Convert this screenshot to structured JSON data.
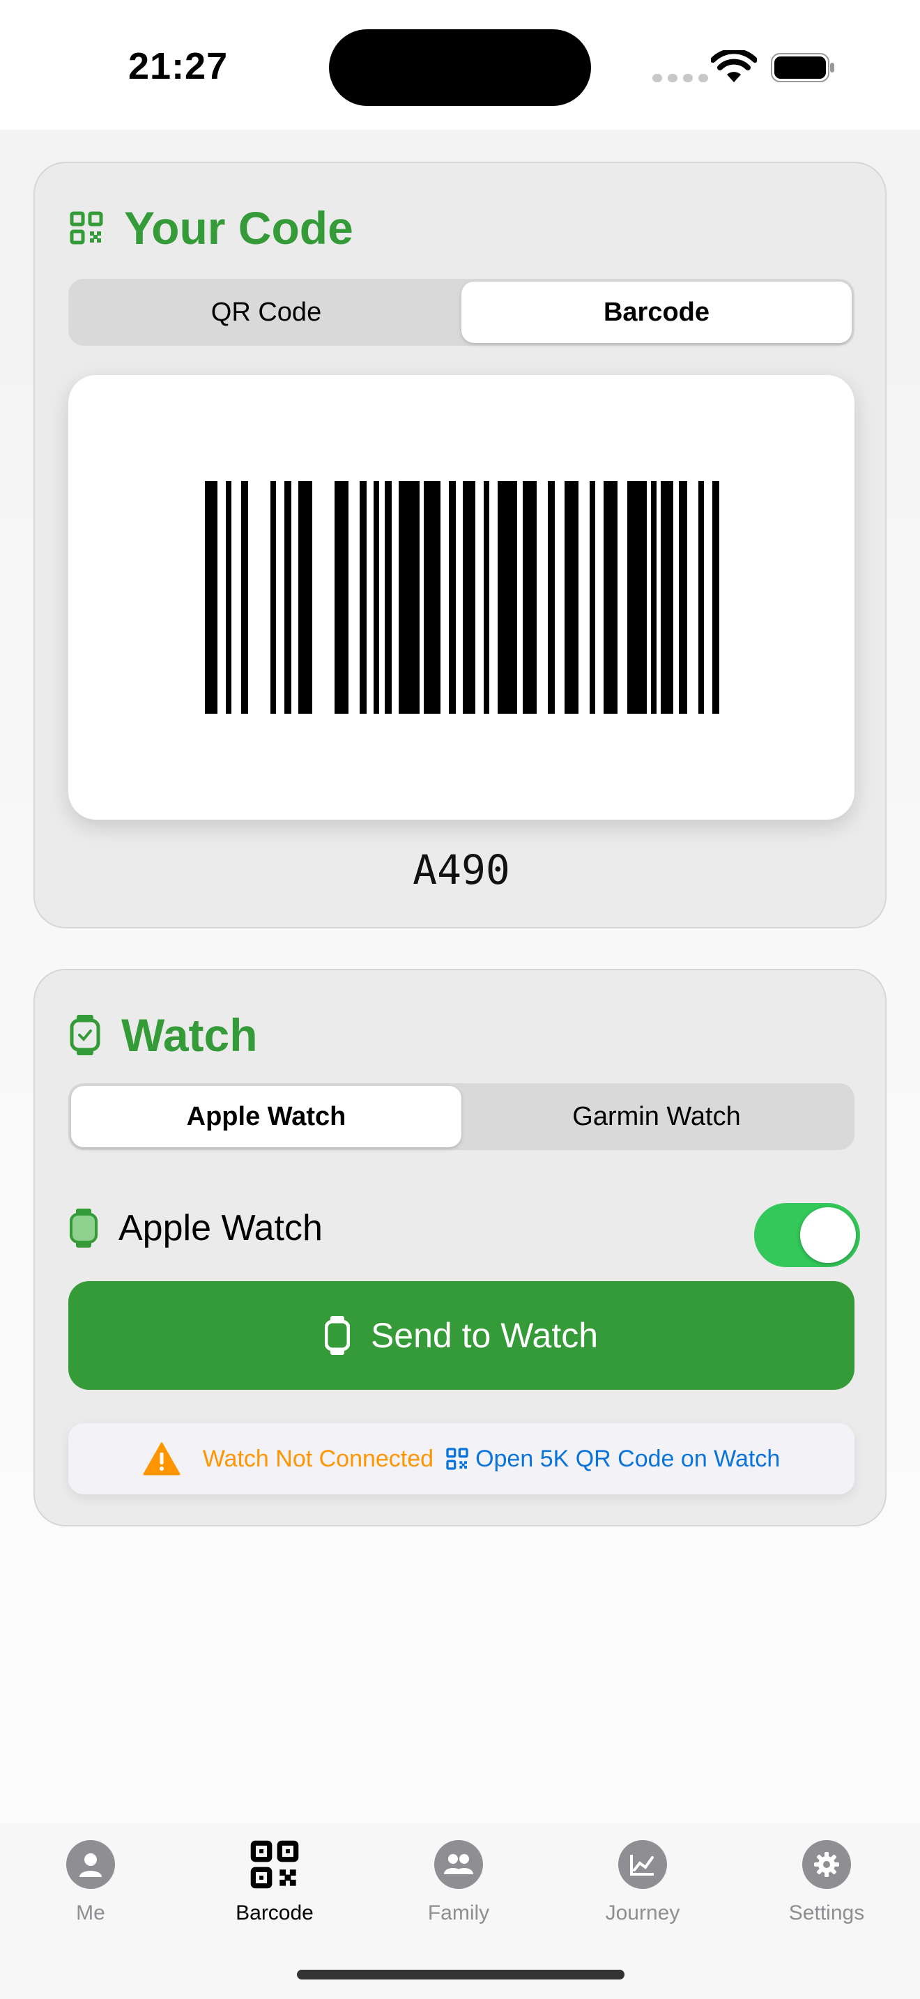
{
  "status_bar": {
    "time": "21:27"
  },
  "code_card": {
    "title": "Your Code",
    "title_icon": "qr-code-icon",
    "tabs": [
      {
        "label": "QR Code",
        "active": false
      },
      {
        "label": "Barcode",
        "active": true
      }
    ],
    "code_value": "A490"
  },
  "watch_card": {
    "title": "Watch",
    "title_icon": "watch-icon",
    "tabs": [
      {
        "label": "Apple Watch",
        "active": true
      },
      {
        "label": "Garmin Watch",
        "active": false
      }
    ],
    "toggle_label": "Apple Watch",
    "toggle_on": true,
    "send_button": "Send to Watch",
    "notice_warning": "Watch Not Connected",
    "notice_link": "Open 5K QR Code on Watch"
  },
  "tab_bar": {
    "items": [
      {
        "label": "Me",
        "icon": "person-icon",
        "active": false
      },
      {
        "label": "Barcode",
        "icon": "qr-code-icon",
        "active": true
      },
      {
        "label": "Family",
        "icon": "family-icon",
        "active": false
      },
      {
        "label": "Journey",
        "icon": "chart-icon",
        "active": false
      },
      {
        "label": "Settings",
        "icon": "gear-icon",
        "active": false
      }
    ]
  },
  "colors": {
    "brand_green": "#359b38",
    "toggle_green": "#34c759",
    "warning_orange": "#ff9500",
    "link_blue": "#0a74da"
  }
}
